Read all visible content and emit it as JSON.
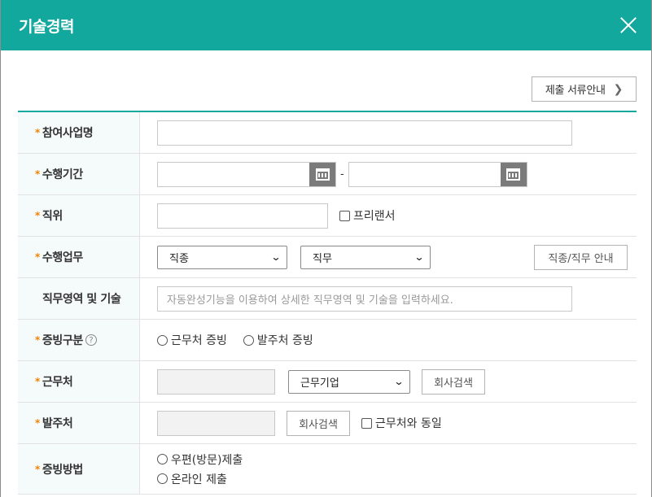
{
  "dialog": {
    "title": "기술경력"
  },
  "guide_button": {
    "label": "제출 서류안내"
  },
  "rows": {
    "project": {
      "label": "참여사업명"
    },
    "period": {
      "label": "수행기간",
      "separator": "-"
    },
    "position": {
      "label": "직위",
      "freelancer_label": "프리랜서"
    },
    "duty": {
      "label": "수행업무",
      "job_type_selected": "직종",
      "job_selected": "직무",
      "guide_label": "직종/직무 안내"
    },
    "area": {
      "label": "직무영역 및 기술",
      "placeholder": "자동완성기능을 이용하여 상세한 직무영역 및 기술을 입력하세요."
    },
    "evidence_type": {
      "label": "증빙구분",
      "help": "?",
      "options": [
        "근무처 증빙",
        "발주처 증빙"
      ]
    },
    "workplace": {
      "label": "근무처",
      "company_type_selected": "근무기업",
      "search_label": "회사검색"
    },
    "client": {
      "label": "발주처",
      "search_label": "회사검색",
      "same_label": "근무처와 동일"
    },
    "evidence_method": {
      "label": "증빙방법",
      "options": [
        "우편(방문)제출",
        "온라인 제출"
      ]
    }
  },
  "required_mark": "*"
}
